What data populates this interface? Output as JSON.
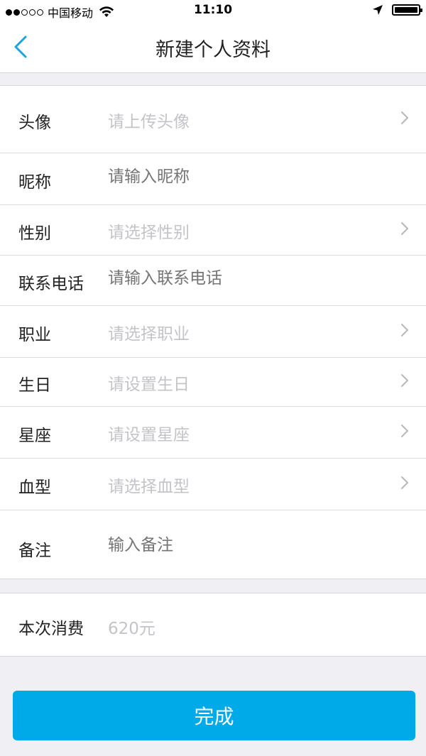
{
  "status_bar": {
    "carrier": "中国移动",
    "time": "11:10",
    "signal_dots": [
      "full",
      "full",
      "empty",
      "empty",
      "empty"
    ]
  },
  "nav": {
    "title": "新建个人资料",
    "back_icon": "chevron-left-icon"
  },
  "form": {
    "rows": [
      {
        "label": "头像",
        "placeholder": "请上传头像",
        "chevron": true
      },
      {
        "label": "昵称",
        "placeholder": "请输入昵称",
        "chevron": false
      },
      {
        "label": "性别",
        "placeholder": "请选择性别",
        "chevron": true
      },
      {
        "label": "联系电话",
        "placeholder": "请输入联系电话",
        "chevron": false
      },
      {
        "label": "职业",
        "placeholder": "请选择职业",
        "chevron": true
      },
      {
        "label": "生日",
        "placeholder": "请设置生日",
        "chevron": true
      },
      {
        "label": "星座",
        "placeholder": "请设置星座",
        "chevron": true
      },
      {
        "label": "血型",
        "placeholder": "请选择血型",
        "chevron": true
      },
      {
        "label": "备注",
        "placeholder": "输入备注",
        "chevron": false
      }
    ]
  },
  "consumption": {
    "label": "本次消费",
    "value": "620元"
  },
  "done_button": {
    "label": "完成"
  },
  "colors": {
    "accent": "#00aae8",
    "background": "#efeff4",
    "placeholder": "#c4c4c8"
  }
}
